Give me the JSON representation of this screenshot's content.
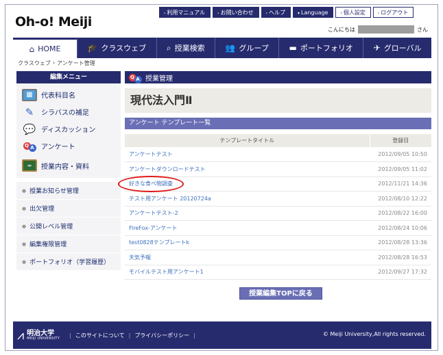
{
  "header": {
    "logo": "Oh-o! Meiji",
    "util_links": [
      "利用マニュアル",
      "お問い合わせ",
      "ヘルプ",
      "Language",
      "個人設定",
      "ログアウト"
    ],
    "greeting_prefix": "こんにちは",
    "greeting_suffix": "さん"
  },
  "nav": {
    "items": [
      "HOME",
      "クラスウェブ",
      "授業検索",
      "グループ",
      "ポートフォリオ",
      "グローバル"
    ]
  },
  "breadcrumb": [
    "クラスウェブ",
    "アンケート管理"
  ],
  "sidebar": {
    "title": "編集メニュー",
    "big_items": [
      "代表科目名",
      "シラバスの補足",
      "ディスカッション",
      "アンケート",
      "授業内容・資料"
    ],
    "small_items": [
      "授業お知らせ管理",
      "出欠管理",
      "公開レベル管理",
      "編集権限管理",
      "ポートフォリオ（学習履歴）"
    ]
  },
  "content": {
    "section_title": "授業管理",
    "course_title": "現代法入門Ⅱ",
    "sub_title": "アンケート テンプレート一覧",
    "table": {
      "headers": [
        "テンプレートタイトル",
        "登録日"
      ],
      "rows": [
        {
          "title": "アンケートテスト",
          "date": "2012/09/05 10:50"
        },
        {
          "title": "アンケートダウンロードテスト",
          "date": "2012/09/05 11:02"
        },
        {
          "title": "好きな食べ物調査",
          "date": "2012/11/21 14:36"
        },
        {
          "title": "テスト用アンケート 20120724a",
          "date": "2012/08/10 12:22"
        },
        {
          "title": "アンケートテスト-2",
          "date": "2012/08/22 16:00"
        },
        {
          "title": "FireFox-アンケート",
          "date": "2012/08/24 10:06"
        },
        {
          "title": "test0828テンプレートk",
          "date": "2012/08/28 13:36"
        },
        {
          "title": "天気予報",
          "date": "2012/08/28 16:53"
        },
        {
          "title": "モバイルテスト用アンケート1",
          "date": "2012/09/27 17:32"
        }
      ]
    },
    "back_button": "授業編集TOPに戻る"
  },
  "footer": {
    "univ_jp": "明治大学",
    "univ_en": "MEIJI UNIVERSITY",
    "links": [
      "このサイトについて",
      "プライバシーポリシー"
    ],
    "copyright": "© Meiji University,All rights reserved."
  }
}
